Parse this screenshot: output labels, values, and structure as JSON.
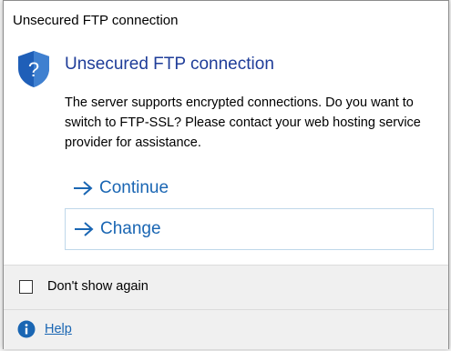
{
  "window": {
    "title": "Unsecured FTP connection"
  },
  "dialog": {
    "heading": "Unsecured FTP connection",
    "message": "The server supports encrypted connections. Do you want to switch to FTP-SSL? Please contact your web hosting service provider for assistance.",
    "icon": "shield-question-icon"
  },
  "commands": [
    {
      "label": "Continue",
      "icon": "arrow-right-icon"
    },
    {
      "label": "Change",
      "icon": "arrow-right-icon"
    }
  ],
  "footer": {
    "checkbox_label": "Don't show again",
    "checkbox_checked": false,
    "help_label": "Help",
    "help_icon": "info-icon"
  },
  "colors": {
    "accent": "#1a66b3",
    "heading": "#1f3d99",
    "shield": "#1f5fb8",
    "footer_bg": "#f0f0f0"
  }
}
